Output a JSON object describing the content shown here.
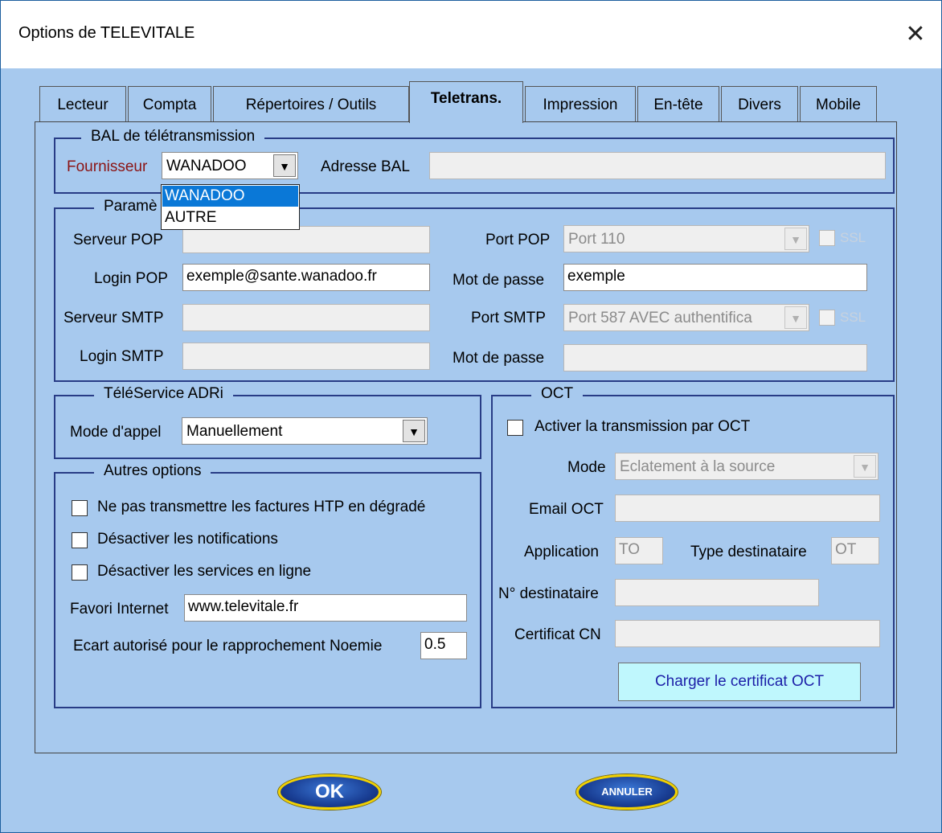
{
  "window": {
    "title": "Options de TELEVITALE",
    "close_symbol": "✕"
  },
  "tabs": [
    {
      "label": "Lecteur"
    },
    {
      "label": "Compta"
    },
    {
      "label": "Répertoires / Outils"
    },
    {
      "label": "Teletrans."
    },
    {
      "label": "Impression"
    },
    {
      "label": "En-tête"
    },
    {
      "label": "Divers"
    },
    {
      "label": "Mobile"
    }
  ],
  "active_tab": "Teletrans.",
  "bal": {
    "legend": "BAL de télétransmission",
    "fournisseur_label": "Fournisseur",
    "fournisseur_value": "WANADOO",
    "adresse_label": "Adresse BAL",
    "adresse_value": "",
    "dropdown_options": [
      "WANADOO",
      "AUTRE"
    ],
    "dropdown_selected": "WANADOO"
  },
  "params": {
    "legend": "Paramè",
    "serveur_pop_label": "Serveur POP",
    "serveur_pop_value": "",
    "login_pop_label": "Login POP",
    "login_pop_value": "exemple@sante.wanadoo.fr",
    "serveur_smtp_label": "Serveur SMTP",
    "serveur_smtp_value": "",
    "login_smtp_label": "Login SMTP",
    "login_smtp_value": "",
    "port_pop_label": "Port POP",
    "port_pop_value": "Port 110",
    "ssl_label": "SSL",
    "mdp_label": "Mot de passe",
    "mdp_pop_value": "exemple",
    "port_smtp_label": "Port SMTP",
    "port_smtp_value": "Port 587 AVEC authentifica",
    "mdp_smtp_value": ""
  },
  "teleservice": {
    "legend": "TéléService ADRi",
    "mode_label": "Mode d'appel",
    "mode_value": "Manuellement"
  },
  "autres": {
    "legend": "Autres options",
    "opt1": "Ne pas transmettre les factures HTP en dégradé",
    "opt2": "Désactiver les notifications",
    "opt3": "Désactiver les services en ligne",
    "favori_label": "Favori Internet",
    "favori_value": "www.televitale.fr",
    "ecart_label": "Ecart autorisé pour le rapprochement Noemie",
    "ecart_value": "0.5"
  },
  "oct": {
    "legend": "OCT",
    "activer_label": "Activer la transmission par OCT",
    "mode_label": "Mode",
    "mode_value": "Eclatement à la source",
    "email_label": "Email OCT",
    "email_value": "",
    "application_label": "Application",
    "application_value": "TO",
    "type_dest_label": "Type destinataire",
    "type_dest_value": "OT",
    "num_dest_label": "N° destinataire",
    "num_dest_value": "",
    "certificat_label": "Certificat CN",
    "certificat_value": "",
    "charger_label": "Charger le certificat OCT"
  },
  "buttons": {
    "ok": "OK",
    "annuler": "ANNULER"
  },
  "colors": {
    "background": "#a7c9ee",
    "group_border": "#283c86",
    "accent_selected": "#0a78d7",
    "fournisseur_label": "#8b1414",
    "cert_button": "#bff7fd"
  }
}
